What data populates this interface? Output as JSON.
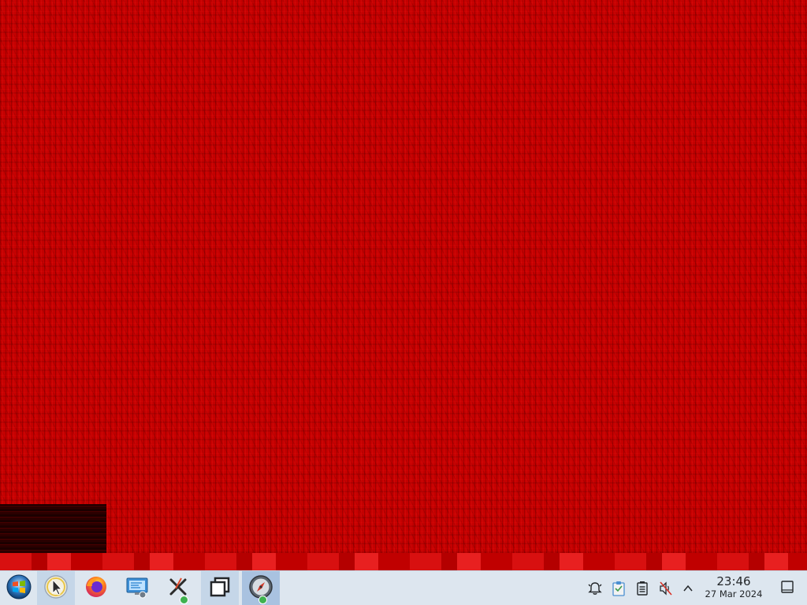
{
  "taskbar": {
    "start_button": {
      "icon": "start-orb-icon"
    },
    "pinned": [
      {
        "name": "Pointer tool",
        "icon": "cursor-icon",
        "state": "active"
      },
      {
        "name": "Firefox",
        "icon": "firefox-icon",
        "state": "normal"
      },
      {
        "name": "System Settings",
        "icon": "display-settings-icon",
        "state": "normal"
      },
      {
        "name": "X tool",
        "icon": "x-app-icon",
        "state": "normal",
        "badge": true
      },
      {
        "name": "Windows",
        "icon": "window-switcher-icon",
        "state": "normal"
      },
      {
        "name": "Compass",
        "icon": "compass-icon",
        "state": "focused",
        "badge": true
      }
    ]
  },
  "tray": {
    "icons": [
      "notifications-icon",
      "clipboard-icon",
      "battery-icon",
      "volume-muted-icon",
      "chevron-up-icon"
    ]
  },
  "clock": {
    "time": "23:46",
    "date": "27 Mar 2024"
  },
  "desktop": {
    "wallpaper_color": "#c40000"
  }
}
